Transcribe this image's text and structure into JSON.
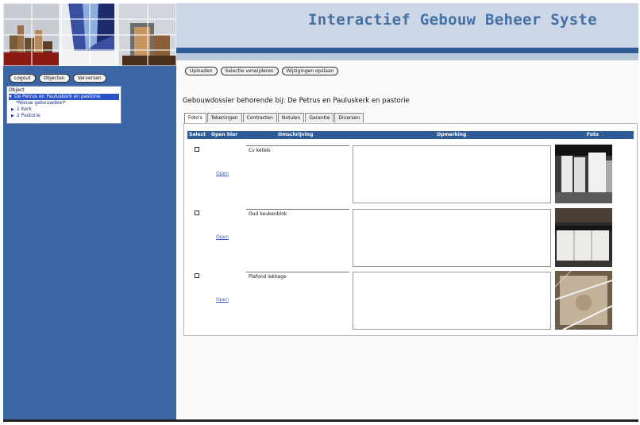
{
  "header": {
    "title": "Interactief Gebouw Beheer Syste"
  },
  "sidebar": {
    "buttons": [
      "Logout",
      "Objecten",
      "Verversen"
    ],
    "tree": {
      "header": "Object",
      "selected": "De Petrus en Pauluskerk en pastorie",
      "items": [
        "*Nieuw gebouwdeel*",
        "1 Kerk",
        "2 Pastorie"
      ]
    }
  },
  "toolbar": {
    "buttons": [
      "Uploaden",
      "Selectie verwijderen",
      "Wijzigingen opslaan"
    ]
  },
  "main": {
    "title": "Gebouwdossier behorende bij: De Petrus en Pauluskerk en pastorie",
    "tabs": [
      "Foto's",
      "Tekeningen",
      "Contracten",
      "Notulen",
      "Garantie",
      "Diversen"
    ],
    "active_tab": "Foto's",
    "columns": [
      "Select",
      "Open hier",
      "Omschrijving",
      "Opmerking",
      "Foto"
    ],
    "rows": [
      {
        "open": "Open",
        "description": "Cv ketels",
        "remark": "",
        "photo": "boiler-room"
      },
      {
        "open": "Open",
        "description": "Oud keukenblok",
        "remark": "",
        "photo": "kitchen"
      },
      {
        "open": "Open",
        "description": "Plafond lekkage",
        "remark": "",
        "photo": "ceiling-leak"
      }
    ]
  },
  "colors": {
    "sidebar": "#3b66a6",
    "header_bg": "#ccd6e4",
    "title": "#4470a5",
    "table_header": "#2f5b97",
    "selection": "#2a52c9",
    "link": "#3b5bd1"
  }
}
